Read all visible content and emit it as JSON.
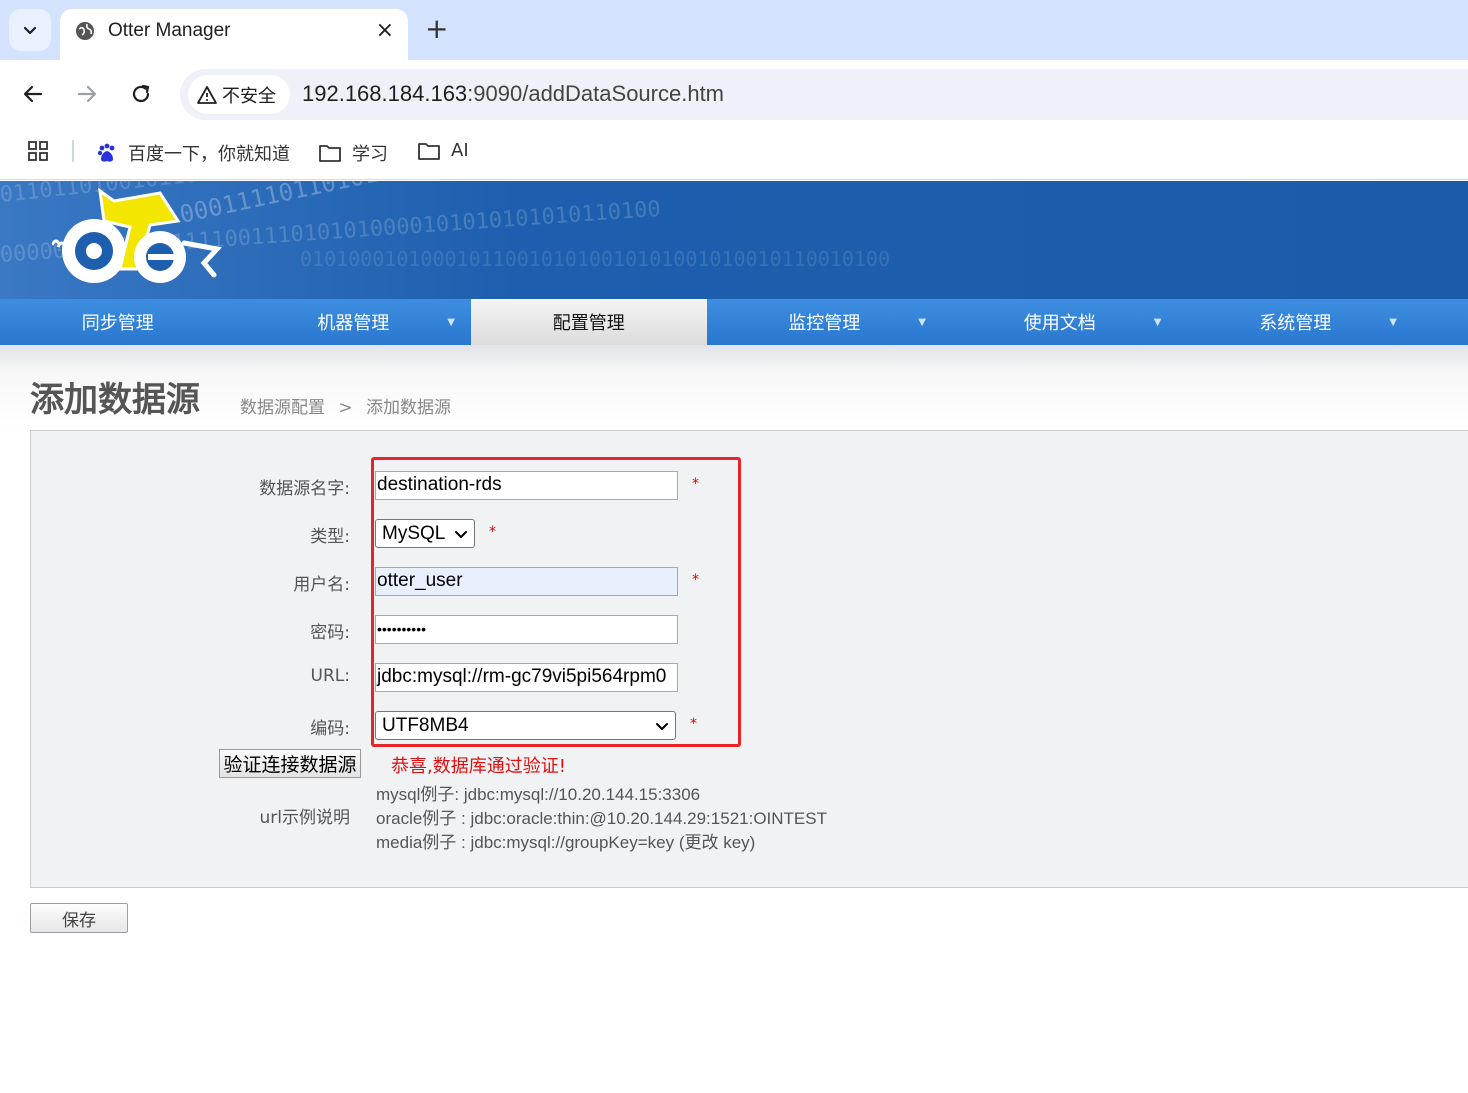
{
  "browser": {
    "tab_title": "Otter Manager",
    "tab_close": "×",
    "new_tab": "+",
    "security_label": "不安全",
    "url_host": "192.168.184.163",
    "url_path": ":9090/addDataSource.htm",
    "bookmarks": [
      {
        "label": "百度一下，你就知道",
        "icon": "baidu-icon"
      },
      {
        "label": "学习",
        "icon": "folder-icon"
      },
      {
        "label": "AI",
        "icon": "folder-icon"
      }
    ]
  },
  "nav": {
    "items": [
      {
        "label": "同步管理",
        "has_caret": false
      },
      {
        "label": "机器管理",
        "has_caret": true
      },
      {
        "label": "配置管理",
        "has_caret": false,
        "active": true
      },
      {
        "label": "监控管理",
        "has_caret": true
      },
      {
        "label": "使用文档",
        "has_caret": true
      },
      {
        "label": "系统管理",
        "has_caret": true
      }
    ],
    "caret": "▼"
  },
  "page": {
    "title": "添加数据源",
    "breadcrumb_parent": "数据源配置",
    "breadcrumb_sep": ">",
    "breadcrumb_current": "添加数据源"
  },
  "form": {
    "name_label": "数据源名字:",
    "name_value": "destination-rds",
    "type_label": "类型:",
    "type_value": "MySQL",
    "user_label": "用户名:",
    "user_value": "otter_user",
    "password_label": "密码:",
    "password_value": "••••••••••",
    "url_label": "URL:",
    "url_value": "jdbc:mysql://rm-gc79vi5pi564rpm0",
    "encoding_label": "编码:",
    "encoding_value": "UTF8MB4",
    "required_mark": "*",
    "verify_button": "验证连接数据源",
    "verify_message": "恭喜,数据库通过验证!",
    "url_help_label": "url示例说明",
    "examples": [
      "mysql例子: jdbc:mysql://10.20.144.15:3306",
      "oracle例子 : jdbc:oracle:thin:@10.20.144.29:1521:OINTEST",
      "media例子 : jdbc:mysql://groupKey=key (更改 key)"
    ],
    "save_button": "保存"
  },
  "colors": {
    "banner": "#1d5fae",
    "menubar": "#2a77cf",
    "highlight_box": "#e5252a",
    "success_message": "#e01010"
  }
}
